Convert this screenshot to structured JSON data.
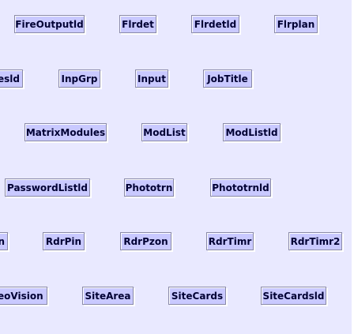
{
  "nodes": [
    "FireOutputld",
    "Flrdet",
    "Flrdetld",
    "Flrplan",
    "esld",
    "InpGrp",
    "Input",
    "JobTitle",
    "MatrixModules",
    "ModList",
    "ModListld",
    "PasswordListld",
    "Phototrn",
    "Phototrnld",
    "n",
    "RdrPin",
    "RdrPzon",
    "RdrTimr",
    "RdrTimr2",
    "eoVision",
    "SiteArea",
    "SiteCards",
    "SiteCardsld"
  ],
  "colors": {
    "canvas_background": "#e9e9ff",
    "node_fill": "#c9c9ff",
    "node_border": "#8a8aa8",
    "node_text": "#000033"
  }
}
